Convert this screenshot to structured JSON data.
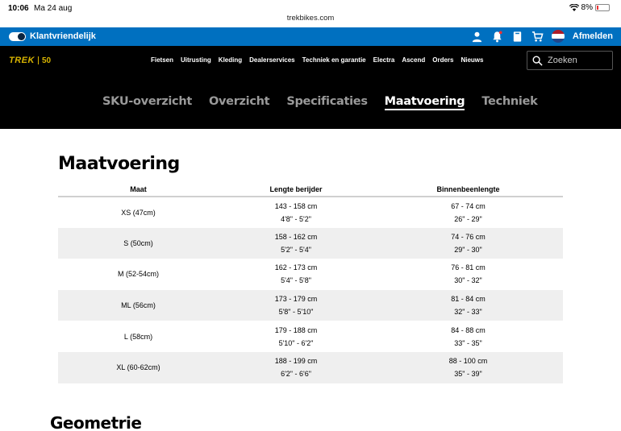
{
  "status": {
    "time": "10:06",
    "date": "Ma 24 aug",
    "battery": "8%"
  },
  "url": "trekbikes.com",
  "topbar": {
    "friendly_label": "Klantvriendelijk",
    "logout_label": "Afmelden"
  },
  "nav": {
    "logo_text": "TREK",
    "logo_badge": "50",
    "items": [
      "Fietsen",
      "Uitrusting",
      "Kleding",
      "Dealerservices",
      "Techniek en garantie",
      "Electra",
      "Ascend",
      "Orders",
      "Nieuws"
    ],
    "search_placeholder": "Zoeken"
  },
  "tabs": [
    "SKU-overzicht",
    "Overzicht",
    "Specificaties",
    "Maatvoering",
    "Techniek"
  ],
  "active_tab": "Maatvoering",
  "section_title": "Maatvoering",
  "table": {
    "headers": [
      "Maat",
      "Lengte berijder",
      "Binnenbeenlengte"
    ],
    "rows": [
      {
        "size": "XS (47cm)",
        "height_cm": "143 - 158 cm",
        "height_ft": "4'8\" - 5'2\"",
        "inseam_cm": "67 - 74 cm",
        "inseam_in": "26\" - 29\""
      },
      {
        "size": "S (50cm)",
        "height_cm": "158 - 162 cm",
        "height_ft": "5'2\" - 5'4\"",
        "inseam_cm": "74 - 76 cm",
        "inseam_in": "29\" - 30\""
      },
      {
        "size": "M (52-54cm)",
        "height_cm": "162 - 173 cm",
        "height_ft": "5'4\" - 5'8\"",
        "inseam_cm": "76 - 81 cm",
        "inseam_in": "30\" - 32\""
      },
      {
        "size": "ML (56cm)",
        "height_cm": "173 - 179 cm",
        "height_ft": "5'8\" - 5'10\"",
        "inseam_cm": "81 - 84 cm",
        "inseam_in": "32\" - 33\""
      },
      {
        "size": "L (58cm)",
        "height_cm": "179 - 188 cm",
        "height_ft": "5'10\" - 6'2\"",
        "inseam_cm": "84 - 88 cm",
        "inseam_in": "33\" - 35\""
      },
      {
        "size": "XL (60-62cm)",
        "height_cm": "188 - 199 cm",
        "height_ft": "6'2\" - 6'6\"",
        "inseam_cm": "88 - 100 cm",
        "inseam_in": "35\" - 39\""
      }
    ]
  },
  "next_section_title": "Geometrie",
  "colors": {
    "accent_blue": "#0070c0",
    "logo_gold": "#d8b400",
    "nav_bg": "#000000"
  },
  "icons": [
    "wifi-icon",
    "battery-icon",
    "user-icon",
    "bell-icon",
    "book-icon",
    "cart-icon",
    "flag-nl-icon",
    "search-icon"
  ]
}
